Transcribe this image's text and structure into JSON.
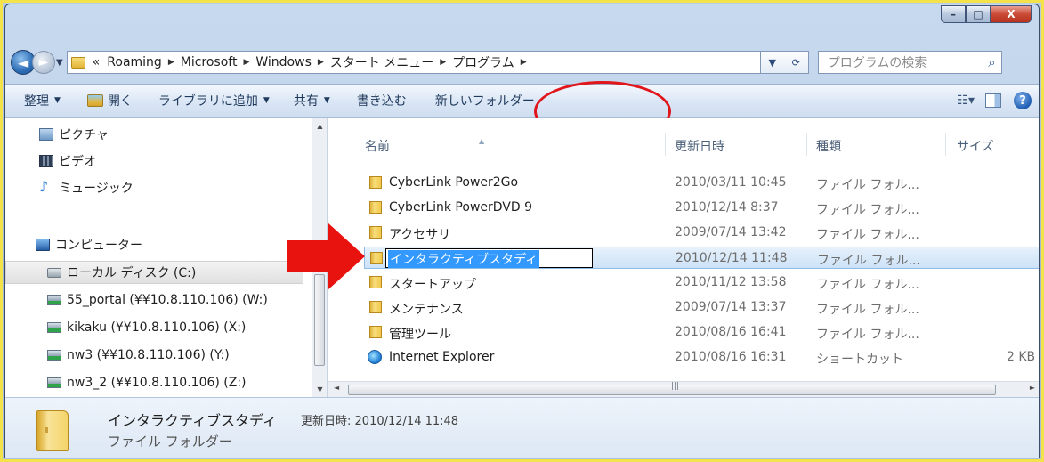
{
  "window": {
    "minimize_glyph": "–",
    "maximize_glyph": "□",
    "close_glyph": "X"
  },
  "address": {
    "overflow": "«",
    "crumbs": [
      "Roaming",
      "Microsoft",
      "Windows",
      "スタート メニュー",
      "プログラム"
    ],
    "search_placeholder": "プログラムの検索"
  },
  "toolbar": {
    "organize": "整理",
    "open": "開く",
    "add_to_library": "ライブラリに追加",
    "share": "共有",
    "burn": "書き込む",
    "new_folder": "新しいフォルダー"
  },
  "nav_pane": {
    "items": [
      {
        "label": "ピクチャ",
        "icon": "pictures-icon"
      },
      {
        "label": "ビデオ",
        "icon": "videos-icon"
      },
      {
        "label": "ミュージック",
        "icon": "music-icon"
      },
      {
        "label": "コンピューター",
        "icon": "computer-icon"
      },
      {
        "label": "ローカル ディスク (C:)",
        "icon": "disk-icon"
      },
      {
        "label": "55_portal (¥¥10.8.110.106) (W:)",
        "icon": "network-drive-icon"
      },
      {
        "label": "kikaku (¥¥10.8.110.106) (X:)",
        "icon": "network-drive-icon"
      },
      {
        "label": "nw3 (¥¥10.8.110.106) (Y:)",
        "icon": "network-drive-icon"
      },
      {
        "label": "nw3_2 (¥¥10.8.110.106) (Z:)",
        "icon": "network-drive-icon"
      }
    ]
  },
  "file_list": {
    "columns": [
      "名前",
      "更新日時",
      "種類",
      "サイズ"
    ],
    "rows": [
      {
        "name": "CyberLink Power2Go",
        "date": "2010/03/11 10:45",
        "type": "ファイル フォル...",
        "size": ""
      },
      {
        "name": "CyberLink PowerDVD 9",
        "date": "2010/12/14 8:37",
        "type": "ファイル フォル...",
        "size": ""
      },
      {
        "name": "アクセサリ",
        "date": "2009/07/14 13:42",
        "type": "ファイル フォル...",
        "size": ""
      },
      {
        "name": "インタラクティブスタディ",
        "date": "2010/12/14 11:48",
        "type": "ファイル フォル...",
        "size": ""
      },
      {
        "name": "スタートアップ",
        "date": "2010/11/12 13:58",
        "type": "ファイル フォル...",
        "size": ""
      },
      {
        "name": "メンテナンス",
        "date": "2009/07/14 13:37",
        "type": "ファイル フォル...",
        "size": ""
      },
      {
        "name": "管理ツール",
        "date": "2010/08/16 16:41",
        "type": "ファイル フォル...",
        "size": ""
      },
      {
        "name": "Internet Explorer",
        "date": "2010/08/16 16:31",
        "type": "ショートカット",
        "size": "2 KB"
      }
    ]
  },
  "details": {
    "name": "インタラクティブスタディ",
    "modified_label": "更新日時:",
    "modified_value": "2010/12/14 11:48",
    "type": "ファイル フォルダー"
  },
  "colors": {
    "highlight_circle": "#e0161b",
    "pointer_arrow": "#e8120f",
    "selection": "#3399ff"
  }
}
